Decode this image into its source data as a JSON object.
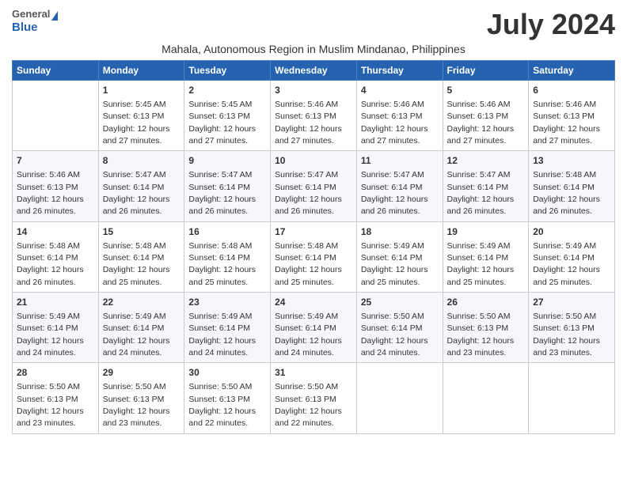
{
  "logo": {
    "general": "General",
    "blue": "Blue"
  },
  "title": "July 2024",
  "subtitle": "Mahala, Autonomous Region in Muslim Mindanao, Philippines",
  "days_header": [
    "Sunday",
    "Monday",
    "Tuesday",
    "Wednesday",
    "Thursday",
    "Friday",
    "Saturday"
  ],
  "weeks": [
    [
      {
        "day": "",
        "info": ""
      },
      {
        "day": "1",
        "info": "Sunrise: 5:45 AM\nSunset: 6:13 PM\nDaylight: 12 hours\nand 27 minutes."
      },
      {
        "day": "2",
        "info": "Sunrise: 5:45 AM\nSunset: 6:13 PM\nDaylight: 12 hours\nand 27 minutes."
      },
      {
        "day": "3",
        "info": "Sunrise: 5:46 AM\nSunset: 6:13 PM\nDaylight: 12 hours\nand 27 minutes."
      },
      {
        "day": "4",
        "info": "Sunrise: 5:46 AM\nSunset: 6:13 PM\nDaylight: 12 hours\nand 27 minutes."
      },
      {
        "day": "5",
        "info": "Sunrise: 5:46 AM\nSunset: 6:13 PM\nDaylight: 12 hours\nand 27 minutes."
      },
      {
        "day": "6",
        "info": "Sunrise: 5:46 AM\nSunset: 6:13 PM\nDaylight: 12 hours\nand 27 minutes."
      }
    ],
    [
      {
        "day": "7",
        "info": "Sunrise: 5:46 AM\nSunset: 6:13 PM\nDaylight: 12 hours\nand 26 minutes."
      },
      {
        "day": "8",
        "info": "Sunrise: 5:47 AM\nSunset: 6:14 PM\nDaylight: 12 hours\nand 26 minutes."
      },
      {
        "day": "9",
        "info": "Sunrise: 5:47 AM\nSunset: 6:14 PM\nDaylight: 12 hours\nand 26 minutes."
      },
      {
        "day": "10",
        "info": "Sunrise: 5:47 AM\nSunset: 6:14 PM\nDaylight: 12 hours\nand 26 minutes."
      },
      {
        "day": "11",
        "info": "Sunrise: 5:47 AM\nSunset: 6:14 PM\nDaylight: 12 hours\nand 26 minutes."
      },
      {
        "day": "12",
        "info": "Sunrise: 5:47 AM\nSunset: 6:14 PM\nDaylight: 12 hours\nand 26 minutes."
      },
      {
        "day": "13",
        "info": "Sunrise: 5:48 AM\nSunset: 6:14 PM\nDaylight: 12 hours\nand 26 minutes."
      }
    ],
    [
      {
        "day": "14",
        "info": "Sunrise: 5:48 AM\nSunset: 6:14 PM\nDaylight: 12 hours\nand 26 minutes."
      },
      {
        "day": "15",
        "info": "Sunrise: 5:48 AM\nSunset: 6:14 PM\nDaylight: 12 hours\nand 25 minutes."
      },
      {
        "day": "16",
        "info": "Sunrise: 5:48 AM\nSunset: 6:14 PM\nDaylight: 12 hours\nand 25 minutes."
      },
      {
        "day": "17",
        "info": "Sunrise: 5:48 AM\nSunset: 6:14 PM\nDaylight: 12 hours\nand 25 minutes."
      },
      {
        "day": "18",
        "info": "Sunrise: 5:49 AM\nSunset: 6:14 PM\nDaylight: 12 hours\nand 25 minutes."
      },
      {
        "day": "19",
        "info": "Sunrise: 5:49 AM\nSunset: 6:14 PM\nDaylight: 12 hours\nand 25 minutes."
      },
      {
        "day": "20",
        "info": "Sunrise: 5:49 AM\nSunset: 6:14 PM\nDaylight: 12 hours\nand 25 minutes."
      }
    ],
    [
      {
        "day": "21",
        "info": "Sunrise: 5:49 AM\nSunset: 6:14 PM\nDaylight: 12 hours\nand 24 minutes."
      },
      {
        "day": "22",
        "info": "Sunrise: 5:49 AM\nSunset: 6:14 PM\nDaylight: 12 hours\nand 24 minutes."
      },
      {
        "day": "23",
        "info": "Sunrise: 5:49 AM\nSunset: 6:14 PM\nDaylight: 12 hours\nand 24 minutes."
      },
      {
        "day": "24",
        "info": "Sunrise: 5:49 AM\nSunset: 6:14 PM\nDaylight: 12 hours\nand 24 minutes."
      },
      {
        "day": "25",
        "info": "Sunrise: 5:50 AM\nSunset: 6:14 PM\nDaylight: 12 hours\nand 24 minutes."
      },
      {
        "day": "26",
        "info": "Sunrise: 5:50 AM\nSunset: 6:13 PM\nDaylight: 12 hours\nand 23 minutes."
      },
      {
        "day": "27",
        "info": "Sunrise: 5:50 AM\nSunset: 6:13 PM\nDaylight: 12 hours\nand 23 minutes."
      }
    ],
    [
      {
        "day": "28",
        "info": "Sunrise: 5:50 AM\nSunset: 6:13 PM\nDaylight: 12 hours\nand 23 minutes."
      },
      {
        "day": "29",
        "info": "Sunrise: 5:50 AM\nSunset: 6:13 PM\nDaylight: 12 hours\nand 23 minutes."
      },
      {
        "day": "30",
        "info": "Sunrise: 5:50 AM\nSunset: 6:13 PM\nDaylight: 12 hours\nand 22 minutes."
      },
      {
        "day": "31",
        "info": "Sunrise: 5:50 AM\nSunset: 6:13 PM\nDaylight: 12 hours\nand 22 minutes."
      },
      {
        "day": "",
        "info": ""
      },
      {
        "day": "",
        "info": ""
      },
      {
        "day": "",
        "info": ""
      }
    ]
  ]
}
